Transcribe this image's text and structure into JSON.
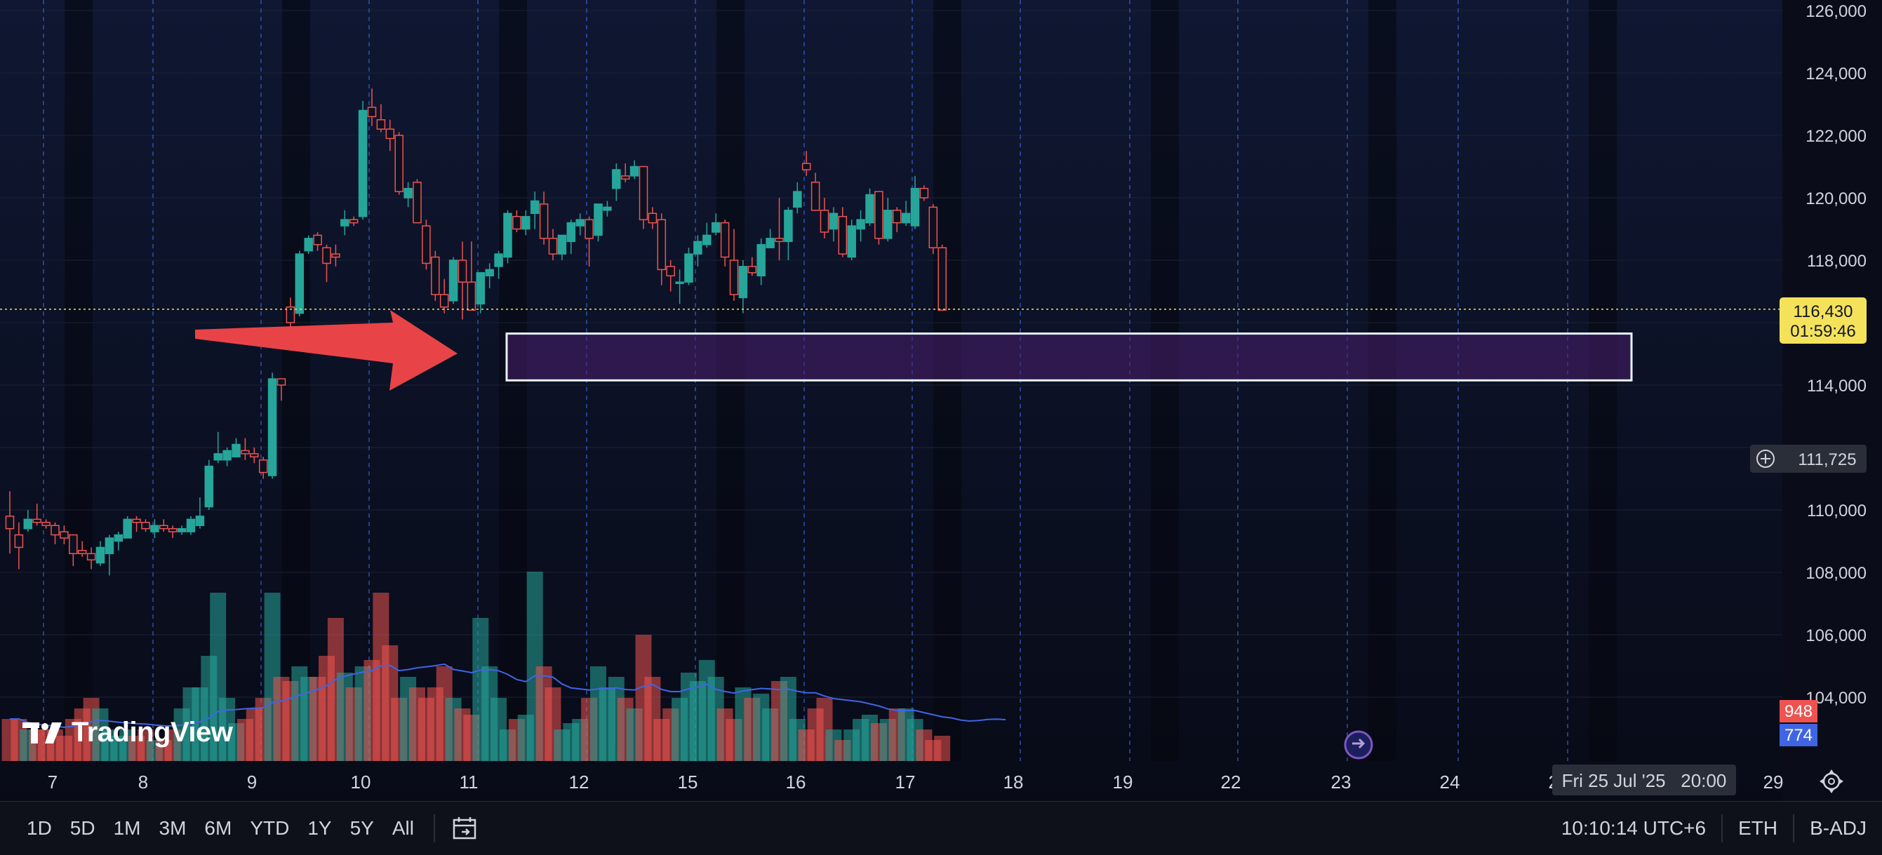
{
  "chart_data": {
    "type": "candlestick",
    "y_axis": {
      "min": 102000,
      "max": 126000,
      "ticks": [
        "126,000",
        "124,000",
        "122,000",
        "120,000",
        "118,000",
        "114,000",
        "110,000",
        "108,000",
        "106,000",
        "104,000"
      ]
    },
    "x_axis": {
      "ticks": [
        "7",
        "8",
        "9",
        "10",
        "11",
        "12",
        "15",
        "16",
        "17",
        "18",
        "19",
        "22",
        "23",
        "24",
        "25",
        "29"
      ]
    },
    "candles": [
      [
        109800,
        110600,
        108600,
        109400
      ],
      [
        109200,
        109600,
        108100,
        108800
      ],
      [
        109400,
        110000,
        109300,
        109700
      ],
      [
        109700,
        110200,
        109500,
        109600
      ],
      [
        109600,
        109700,
        109400,
        109500
      ],
      [
        109500,
        109600,
        108900,
        109200
      ],
      [
        109300,
        109500,
        108900,
        109100
      ],
      [
        109200,
        109200,
        108200,
        108600
      ],
      [
        108700,
        109000,
        108500,
        108600
      ],
      [
        108600,
        108800,
        108100,
        108400
      ],
      [
        108300,
        109000,
        108200,
        108800
      ],
      [
        108600,
        109200,
        107900,
        109100
      ],
      [
        109000,
        109300,
        108700,
        109200
      ],
      [
        109100,
        109800,
        109100,
        109700
      ],
      [
        109700,
        109800,
        109300,
        109600
      ],
      [
        109600,
        109700,
        109300,
        109400
      ],
      [
        109300,
        109700,
        109100,
        109500
      ],
      [
        109500,
        109700,
        109300,
        109400
      ],
      [
        109400,
        109500,
        109100,
        109300
      ],
      [
        109300,
        109500,
        109200,
        109400
      ],
      [
        109300,
        109800,
        109200,
        109700
      ],
      [
        109500,
        110400,
        109400,
        109800
      ],
      [
        110100,
        111600,
        110000,
        111400
      ],
      [
        111600,
        112500,
        111500,
        111800
      ],
      [
        111600,
        112000,
        111400,
        111900
      ],
      [
        111700,
        112300,
        111700,
        112100
      ],
      [
        111900,
        112300,
        111600,
        111800
      ],
      [
        111800,
        112000,
        111500,
        111700
      ],
      [
        111600,
        111700,
        111000,
        111200
      ],
      [
        111100,
        114400,
        111000,
        114200
      ],
      [
        114200,
        114200,
        113500,
        114000
      ],
      [
        116500,
        116800,
        115600,
        116000
      ],
      [
        116300,
        118300,
        116200,
        118200
      ],
      [
        118300,
        118800,
        118200,
        118700
      ],
      [
        118800,
        118900,
        118300,
        118500
      ],
      [
        118400,
        118500,
        117300,
        117900
      ],
      [
        118200,
        118500,
        117800,
        118100
      ],
      [
        119100,
        119600,
        118800,
        119300
      ],
      [
        119300,
        119400,
        119100,
        119200
      ],
      [
        119400,
        123100,
        119300,
        122800
      ],
      [
        122900,
        123500,
        122300,
        122600
      ],
      [
        122500,
        123000,
        122100,
        122200
      ],
      [
        122200,
        122500,
        121500,
        121900
      ],
      [
        122000,
        122100,
        120100,
        120200
      ],
      [
        120000,
        120500,
        119700,
        120300
      ],
      [
        120500,
        120600,
        119200,
        119200
      ],
      [
        119100,
        119300,
        117700,
        117900
      ],
      [
        118100,
        118300,
        116700,
        116900
      ],
      [
        116900,
        117400,
        116300,
        116500
      ],
      [
        116700,
        118100,
        116600,
        118000
      ],
      [
        118000,
        118600,
        116100,
        117300
      ],
      [
        117300,
        118600,
        116500,
        116400
      ],
      [
        116600,
        117600,
        116300,
        117600
      ],
      [
        117500,
        117900,
        117100,
        117700
      ],
      [
        117800,
        118300,
        117400,
        118200
      ],
      [
        118100,
        119600,
        117900,
        119500
      ],
      [
        119400,
        119600,
        118900,
        119000
      ],
      [
        119000,
        119600,
        118800,
        119400
      ],
      [
        119500,
        120200,
        119000,
        119900
      ],
      [
        119800,
        120200,
        118500,
        118700
      ],
      [
        118700,
        119000,
        118000,
        118200
      ],
      [
        118200,
        118800,
        118000,
        118800
      ],
      [
        118600,
        119300,
        118200,
        119200
      ],
      [
        119100,
        119500,
        118800,
        119300
      ],
      [
        119300,
        119400,
        117800,
        118700
      ],
      [
        118800,
        119800,
        118600,
        119800
      ],
      [
        119600,
        119900,
        119400,
        119700
      ],
      [
        120300,
        121100,
        119900,
        120900
      ],
      [
        120700,
        121100,
        120500,
        120600
      ],
      [
        120700,
        121200,
        120600,
        121000
      ],
      [
        121000,
        121000,
        119000,
        119300
      ],
      [
        119500,
        119700,
        119000,
        119200
      ],
      [
        119300,
        119500,
        117200,
        117700
      ],
      [
        117800,
        118000,
        117000,
        117500
      ],
      [
        117300,
        117700,
        116600,
        117300
      ],
      [
        117300,
        118400,
        117200,
        118200
      ],
      [
        118200,
        118800,
        117800,
        118600
      ],
      [
        118500,
        119200,
        118400,
        118800
      ],
      [
        118900,
        119500,
        118800,
        119200
      ],
      [
        119200,
        119300,
        117800,
        118100
      ],
      [
        118000,
        119000,
        116700,
        116900
      ],
      [
        116800,
        118000,
        116300,
        117800
      ],
      [
        117800,
        118100,
        117500,
        117600
      ],
      [
        117500,
        118700,
        117200,
        118500
      ],
      [
        118400,
        119000,
        118400,
        118700
      ],
      [
        118700,
        120000,
        118000,
        118600
      ],
      [
        118600,
        119700,
        118000,
        119600
      ],
      [
        119700,
        120500,
        119500,
        120200
      ],
      [
        121100,
        121500,
        120700,
        120900
      ],
      [
        120500,
        120800,
        119700,
        119600
      ],
      [
        119600,
        120000,
        118700,
        118900
      ],
      [
        119000,
        119700,
        118600,
        119500
      ],
      [
        119400,
        119700,
        118100,
        118200
      ],
      [
        118100,
        119300,
        118000,
        119100
      ],
      [
        119000,
        119600,
        118600,
        119300
      ],
      [
        119200,
        120300,
        119100,
        120100
      ],
      [
        120200,
        120200,
        118500,
        118700
      ],
      [
        118700,
        120000,
        118600,
        119600
      ],
      [
        119600,
        119700,
        118900,
        119200
      ],
      [
        119200,
        119900,
        119100,
        119500
      ],
      [
        119100,
        120700,
        119000,
        120300
      ],
      [
        120300,
        120400,
        119900,
        120000
      ],
      [
        119700,
        119800,
        118200,
        118400
      ],
      [
        118400,
        118500,
        116500,
        116400
      ]
    ],
    "volume": [
      20,
      20,
      15,
      15,
      15,
      15,
      12,
      20,
      25,
      30,
      25,
      15,
      12,
      15,
      12,
      15,
      10,
      10,
      15,
      25,
      35,
      35,
      50,
      80,
      30,
      18,
      20,
      25,
      30,
      80,
      40,
      38,
      45,
      40,
      40,
      50,
      68,
      42,
      35,
      45,
      48,
      80,
      55,
      30,
      40,
      35,
      30,
      35,
      45,
      30,
      25,
      22,
      68,
      45,
      30,
      15,
      20,
      22,
      90,
      45,
      35,
      15,
      18,
      20,
      30,
      45,
      35,
      40,
      30,
      25,
      60,
      40,
      20,
      25,
      30,
      42,
      38,
      48,
      40,
      25,
      20,
      35,
      30,
      32,
      25,
      38,
      40,
      20,
      15,
      25,
      30,
      15,
      10,
      15,
      20,
      22,
      18,
      20,
      25,
      25,
      20,
      15,
      10,
      12,
      15,
      18,
      30,
      25,
      25,
      28,
      25
    ]
  },
  "price_labels": {
    "current_price": "116,430",
    "countdown": "01:59:46",
    "crosshair_price": "111,725"
  },
  "volume_labels": {
    "vol": "948",
    "vol_ma": "774"
  },
  "x_crosshair_label": "Fri 25 Jul '25   20:00",
  "watermark": "TradingView",
  "timeframes": [
    "1D",
    "5D",
    "1M",
    "3M",
    "6M",
    "YTD",
    "1Y",
    "5Y",
    "All"
  ],
  "status": {
    "clock": "10:10:14 UTC+6",
    "exchange": "ETH",
    "adjust": "B-ADJ"
  },
  "colors": {
    "up": "#26a69a",
    "down": "#ef5350",
    "current_price_bg": "#f5e25b",
    "zone_fill": "#4a1f6e",
    "arrow": "#e53e3e",
    "vol_ma_line": "#3f65e3"
  }
}
